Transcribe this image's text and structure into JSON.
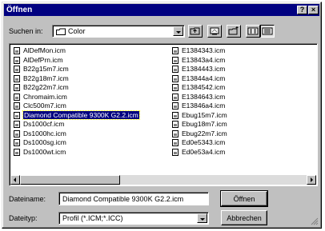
{
  "window": {
    "title": "Öffnen",
    "help_glyph": "?",
    "close_glyph": "×"
  },
  "lookin": {
    "label": "Suchen in:",
    "value": "Color",
    "folder_icon": "folder-icon"
  },
  "toolbar": {
    "icons": [
      "up-folder-icon",
      "desktop-icon",
      "new-folder-icon",
      "list-view-icon",
      "details-view-icon"
    ]
  },
  "files": {
    "left": [
      "AlDefMon.icm",
      "AlDefPrn.icm",
      "B22g15m7.icm",
      "B22g18m7.icm",
      "B22g22m7.icm",
      "Chromaim.icm",
      "Clc500m7.icm",
      "Diamond Compatible 9300K G2.2.icm",
      "Ds1000cf.icm",
      "Ds1000hc.icm",
      "Ds1000sg.icm",
      "Ds1000wt.icm"
    ],
    "right": [
      "E1384343.icm",
      "E13843a4.icm",
      "E1384443.icm",
      "E13844a4.icm",
      "E1384542.icm",
      "E1384643.icm",
      "E13846a4.icm",
      "Ebug15m7.icm",
      "Ebug18m7.icm",
      "Ebug22m7.icm",
      "Ed0e5343.icm",
      "Ed0e53a4.icm"
    ],
    "selected": "Diamond Compatible 9300K G2.2.icm"
  },
  "filename": {
    "label": "Dateiname:",
    "value": "Diamond Compatible 9300K G2.2.icm"
  },
  "filetype": {
    "label": "Dateityp:",
    "value": "Profil (*.ICM;*.ICC)"
  },
  "buttons": {
    "open": "Öffnen",
    "cancel": "Abbrechen"
  }
}
